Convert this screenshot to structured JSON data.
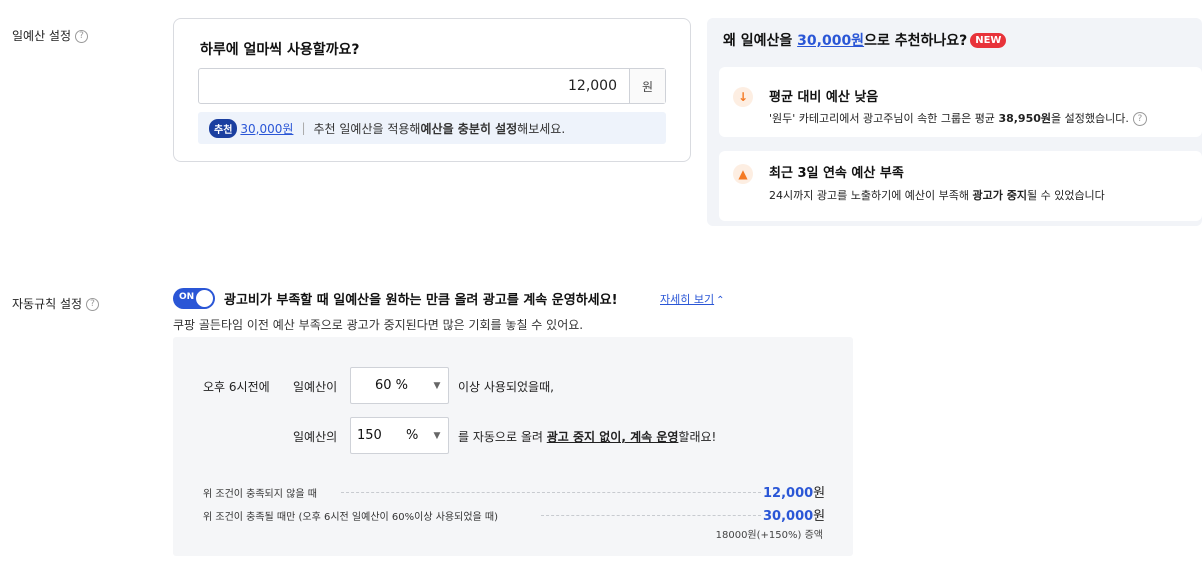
{
  "daily_budget": {
    "section_label": "일예산 설정",
    "question": "하루에 얼마씩 사용할까요?",
    "input_value": "12,000",
    "unit": "원",
    "recommend": {
      "badge": "추천",
      "amount": "30,000원",
      "text_prefix": "추천 일예산을 적용해 ",
      "text_bold": "예산을 충분히 설정",
      "text_suffix": "해보세요."
    }
  },
  "why_panel": {
    "title_prefix": "왜 일예산을 ",
    "title_amount": "30,000원",
    "title_suffix": "으로 추천하나요?",
    "badge": "NEW",
    "reasons": [
      {
        "icon": "arrow-down-icon",
        "title": "평균 대비 예산 낮음",
        "desc_prefix": "'원두' 카테고리에서 광고주님이 속한 그룹은 평균 ",
        "desc_bold": "38,950원",
        "desc_suffix": "을 설정했습니다."
      },
      {
        "icon": "warning-icon",
        "title": "최근 3일 연속 예산 부족",
        "desc_prefix": "24시까지 광고를 노출하기에 예산이 부족해 ",
        "desc_bold": "광고가 중지",
        "desc_suffix": "될 수 있었습니다"
      }
    ]
  },
  "auto_rule": {
    "section_label": "자동규칙 설정",
    "toggle_label": "ON",
    "headline": "광고비가 부족할 때 일예산을 원하는 만큼 올려 광고를 계속 운영하세요!",
    "detail_link": "자세히 보기",
    "subtext": "쿠팡 골든타임 이전 예산 부족으로 광고가 중지된다면 많은 기회를 놓칠 수 있어요.",
    "row1": {
      "time": "오후 6시전에",
      "label": "일예산이",
      "select_value": "60 %",
      "suffix": "이상 사용되었을때,"
    },
    "row2": {
      "label": "일예산의",
      "input_value": "150",
      "unit": "%",
      "suffix_prefix": "를 자동으로 올려 ",
      "suffix_emph": "광고 중지 없이, 계속 운영",
      "suffix_end": "할래요!"
    },
    "summary": [
      {
        "label": "위 조건이 충족되지 않을 때",
        "value": "12,000",
        "won": "원"
      },
      {
        "label": "위 조건이 충족될 때만 (오후 6시전 일예산이 60%이상 사용되었을 때)",
        "value": "30,000",
        "won": "원"
      }
    ],
    "note": "18000원(+150%) 증액"
  },
  "colors": {
    "accent": "#2a56d6",
    "badge_new": "#e8333a",
    "badge_recommend": "#1b3fa0",
    "warning": "#f47a24"
  }
}
